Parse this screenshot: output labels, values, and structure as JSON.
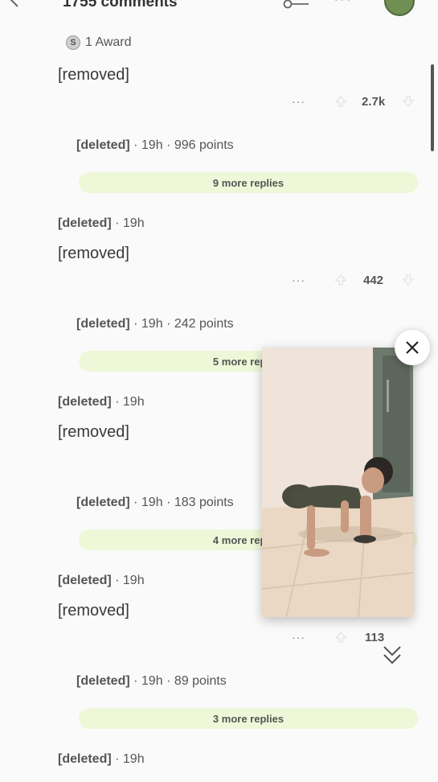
{
  "header": {
    "title": "1755 comments"
  },
  "comments": [
    {
      "award": "1 Award",
      "body": "[removed]",
      "score": "2.7k",
      "reply": {
        "author": "[deleted]",
        "age": "19h",
        "points": "996 points"
      },
      "more_replies": "9 more replies"
    },
    {
      "author": "[deleted]",
      "age": "19h",
      "body": "[removed]",
      "score": "442",
      "reply": {
        "author": "[deleted]",
        "age": "19h",
        "points": "242 points"
      },
      "more_replies": "5 more replies"
    },
    {
      "author": "[deleted]",
      "age": "19h",
      "body": "[removed]",
      "score": "",
      "reply": {
        "author": "[deleted]",
        "age": "19h",
        "points": "183 points"
      },
      "more_replies": "4 more replies"
    },
    {
      "author": "[deleted]",
      "age": "19h",
      "body": "[removed]",
      "score": "113",
      "reply": {
        "author": "[deleted]",
        "age": "19h",
        "points": "89 points"
      },
      "more_replies": "3 more replies"
    },
    {
      "author": "[deleted]",
      "age": "19h"
    }
  ],
  "separator": "·",
  "icons": {
    "back": "chevron-left-icon",
    "sort": "key-icon",
    "more": "more-horizontal-icon",
    "award": "award-icon",
    "upvote": "upvote-icon",
    "downvote": "downvote-icon",
    "close": "close-icon",
    "collapse": "double-chevron-down-icon"
  },
  "colors": {
    "background": "#fafafa",
    "more_replies_bg": "#eef8d8",
    "text": "#555555"
  }
}
